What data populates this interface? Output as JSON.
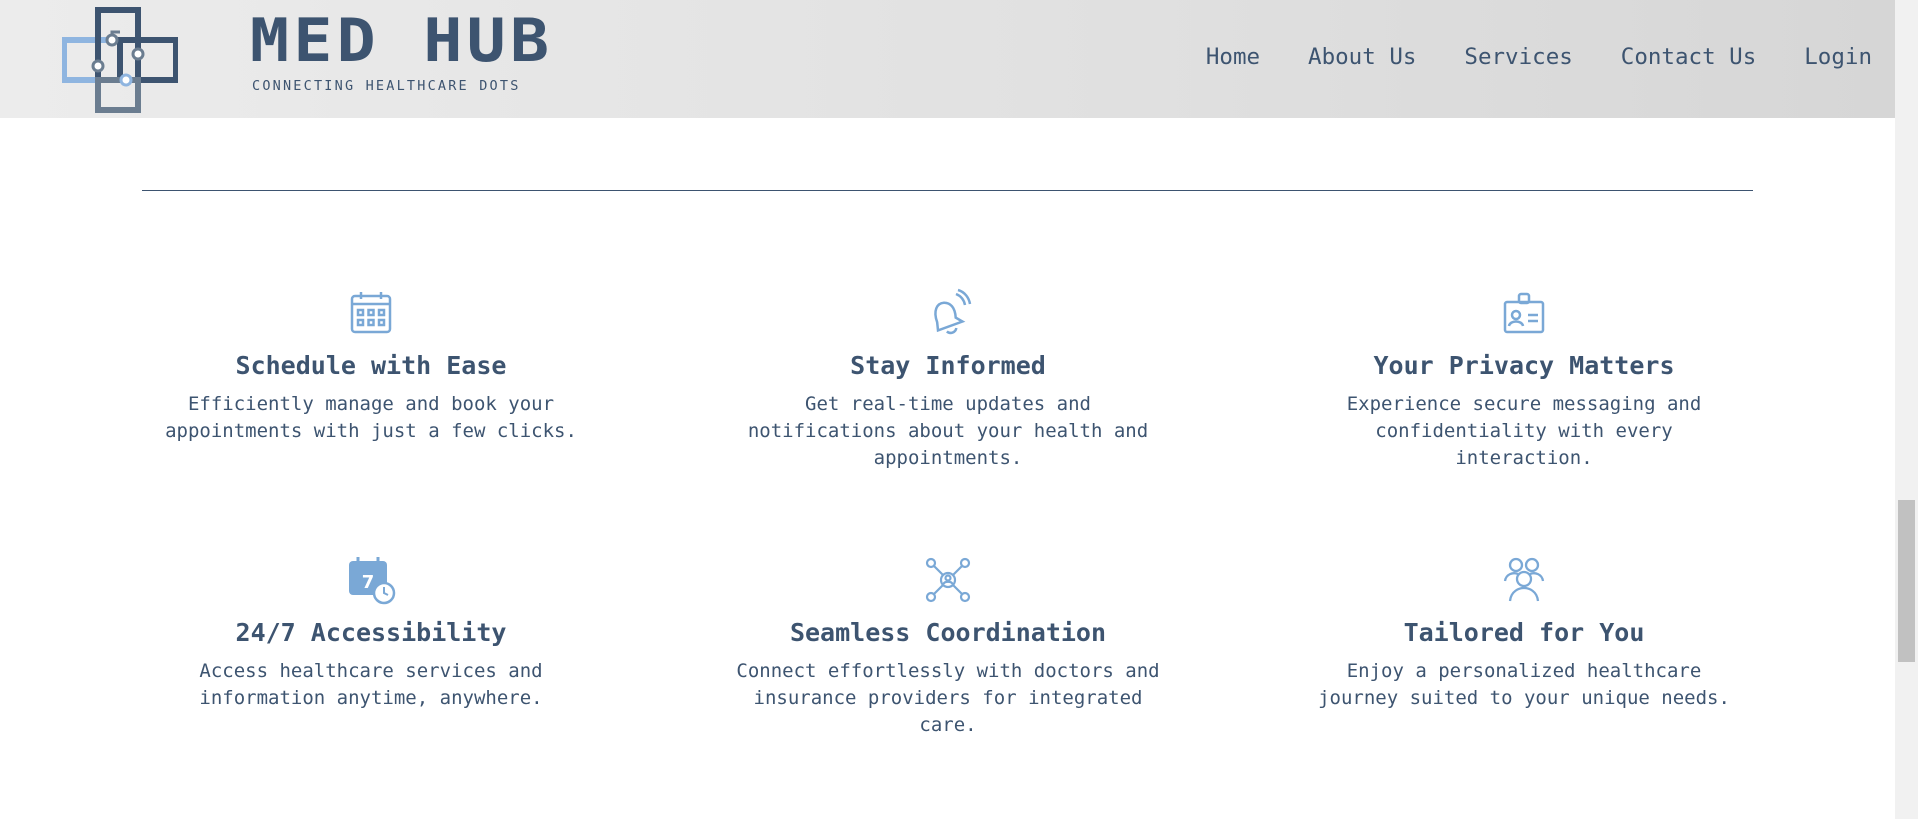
{
  "header": {
    "logo": {
      "wordmark": "MED HUB",
      "tagline": "CONNECTING HEALTHCARE DOTS"
    },
    "nav": [
      "Home",
      "About Us",
      "Services",
      "Contact Us",
      "Login"
    ]
  },
  "features": [
    {
      "icon": "calendar-icon",
      "title": "Schedule with Ease",
      "text": "Efficiently manage and book your appointments with just a few clicks."
    },
    {
      "icon": "bell-icon",
      "title": "Stay Informed",
      "text": "Get real-time updates and notifications about your health and appointments."
    },
    {
      "icon": "id-badge-icon",
      "title": "Your Privacy Matters",
      "text": "Experience secure messaging and confidentiality with every interaction."
    },
    {
      "icon": "calendar-clock-icon",
      "title": "24/7 Accessibility",
      "text": "Access healthcare services and information anytime, anywhere.",
      "icon_text": "7"
    },
    {
      "icon": "network-icon",
      "title": "Seamless Coordination",
      "text": "Connect effortlessly with doctors and insurance providers for integrated care."
    },
    {
      "icon": "users-icon",
      "title": "Tailored for You",
      "text": "Enjoy a personalized healthcare journey suited to your unique needs."
    }
  ],
  "colors": {
    "brand": "#3d5470",
    "icon": "#7aa8d6",
    "logo_light": "#8fb5e0",
    "header_bg": "#e2e2e2"
  }
}
